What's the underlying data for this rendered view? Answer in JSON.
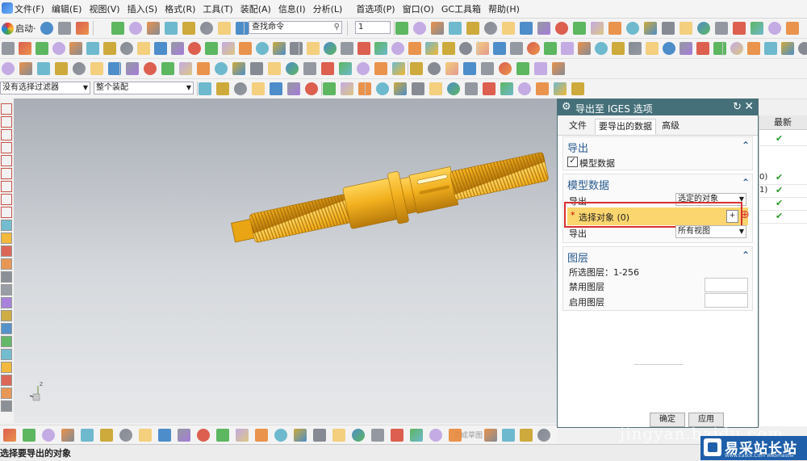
{
  "menu": {
    "items": [
      "文件(F)",
      "编辑(E)",
      "视图(V)",
      "插入(S)",
      "格式(R)",
      "工具(T)",
      "装配(A)",
      "信息(I)",
      "分析(L)",
      "首选项(P)",
      "窗口(O)",
      "GC工具箱",
      "帮助(H)"
    ]
  },
  "toolbar": {
    "start_label": "启动·",
    "search_placeholder": "查找命令",
    "number_select": "1",
    "filter_select": "没有选择过滤器",
    "assembly_select": "整个装配"
  },
  "dialog": {
    "title": "导出至 IGES 选项",
    "tabs": [
      {
        "label": "文件",
        "active": false
      },
      {
        "label": "要导出的数据",
        "active": true
      },
      {
        "label": "高级",
        "active": false
      }
    ],
    "export_group": {
      "title": "导出",
      "model_data_checkbox": {
        "label": "模型数据",
        "checked": true
      }
    },
    "model_group": {
      "title": "模型数据",
      "export_label": "导出",
      "export_value": "选定的对象",
      "select_object": "选择对象 (0)",
      "export2_label": "导出",
      "export2_value": "所有视图"
    },
    "layer_group": {
      "title": "图层",
      "selected_layers": "所选图层：1-256",
      "disabled_layers": "禁用图层",
      "enabled_layers": "启用图层"
    },
    "buttons": {
      "ok": "确定",
      "apply": "应用"
    }
  },
  "right_panel": {
    "header": "最新",
    "rows": [
      {
        "paren": "",
        "check": "✔"
      },
      {
        "paren": "0)",
        "check": "✔"
      },
      {
        "paren": "1)",
        "check": "✔"
      },
      {
        "paren": "",
        "check": "✔"
      },
      {
        "paren": "",
        "check": "✔"
      }
    ]
  },
  "bottom_toolbar": {
    "sketch_label": "完成草图"
  },
  "status": {
    "message": "选择要导出的对象"
  },
  "watermark": {
    "text": "jingyan.baidu.com",
    "brand": "易采站长站",
    "brand_sub": "Www.Easck.Com Webmaster"
  },
  "colors": {
    "dialog_title_bg": "#45707a",
    "selection_row_bg": "#fbd66f",
    "highlight_border": "#d83030",
    "part_color": "#f2b01e"
  }
}
